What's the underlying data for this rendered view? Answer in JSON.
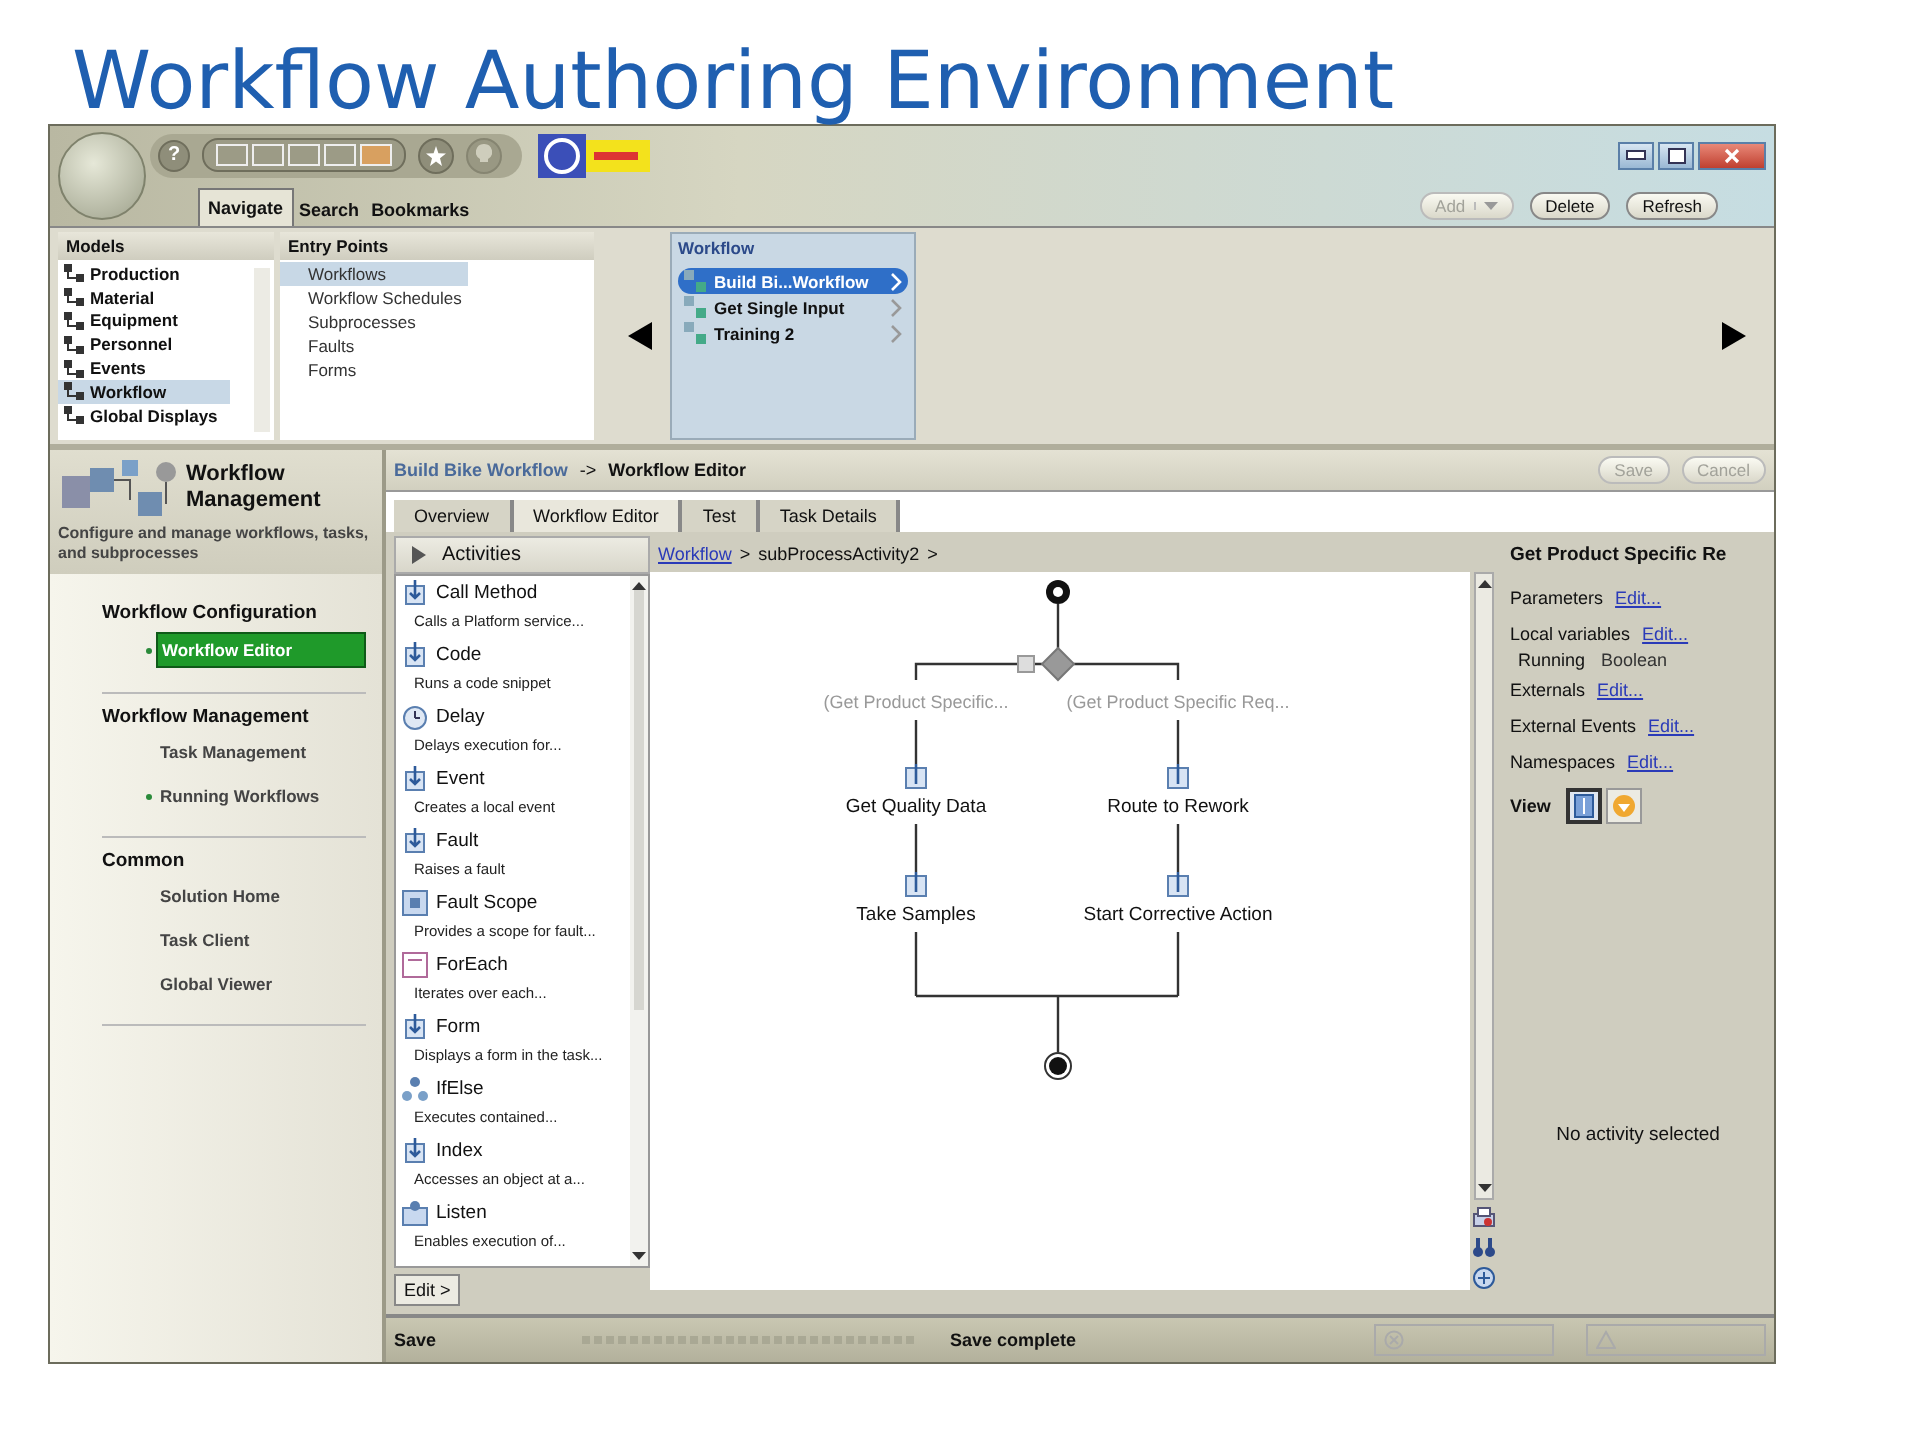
{
  "slide_title": "Workflow Authoring Environment",
  "toolbar": {
    "help": "?"
  },
  "nav_tabs": [
    {
      "label": "Navigate",
      "selected": true
    },
    {
      "label": "Search",
      "selected": false
    },
    {
      "label": "Bookmarks",
      "selected": false
    }
  ],
  "nav_actions": [
    {
      "label": "Add",
      "disabled": true,
      "dropdown": true
    },
    {
      "label": "Delete",
      "disabled": false,
      "dropdown": false
    },
    {
      "label": "Refresh",
      "disabled": false,
      "dropdown": false
    }
  ],
  "models": {
    "title": "Models",
    "items": [
      {
        "label": "Production",
        "selected": false
      },
      {
        "label": "Material",
        "selected": false
      },
      {
        "label": "Equipment",
        "selected": false
      },
      {
        "label": "Personnel",
        "selected": false
      },
      {
        "label": "Events",
        "selected": false
      },
      {
        "label": "Workflow",
        "selected": true
      },
      {
        "label": "Global Displays",
        "selected": false
      }
    ]
  },
  "entry_points": {
    "title": "Entry Points",
    "items": [
      {
        "label": "Workflows",
        "selected": true
      },
      {
        "label": "Workflow Schedules",
        "selected": false
      },
      {
        "label": "Subprocesses",
        "selected": false
      },
      {
        "label": "Faults",
        "selected": false
      },
      {
        "label": "Forms",
        "selected": false
      }
    ]
  },
  "workflows": {
    "title": "Workflow",
    "items": [
      {
        "label": "Build Bi...Workflow",
        "selected": true
      },
      {
        "label": "Get Single Input",
        "selected": false
      },
      {
        "label": "Training 2",
        "selected": false
      }
    ]
  },
  "sidebar": {
    "title": "Workflow Management",
    "description": "Configure and manage workflows, tasks, and subprocesses",
    "sections": [
      {
        "heading": "Workflow Configuration",
        "items": [
          {
            "label": "Workflow Editor",
            "selected": true,
            "bullet": true
          }
        ]
      },
      {
        "heading": "Workflow Management",
        "items": [
          {
            "label": "Task Management",
            "selected": false,
            "bullet": false
          },
          {
            "label": "Running Workflows",
            "selected": false,
            "bullet": true
          }
        ]
      },
      {
        "heading": "Common",
        "items": [
          {
            "label": "Solution Home",
            "selected": false,
            "bullet": false
          },
          {
            "label": "Task Client",
            "selected": false,
            "bullet": false
          },
          {
            "label": "Global Viewer",
            "selected": false,
            "bullet": false
          }
        ]
      }
    ]
  },
  "editor": {
    "crumb_link": "Build Bike Workflow",
    "crumb_separator": "->",
    "crumb_current": "Workflow Editor",
    "buttons": [
      {
        "label": "Save",
        "disabled": true
      },
      {
        "label": "Cancel",
        "disabled": true
      }
    ],
    "tabs": [
      {
        "label": "Overview",
        "selected": false
      },
      {
        "label": "Workflow Editor",
        "selected": true
      },
      {
        "label": "Test",
        "selected": false
      },
      {
        "label": "Task Details",
        "selected": false
      }
    ]
  },
  "activities": {
    "title": "Activities",
    "edit_button": "Edit >",
    "items": [
      {
        "name": "Call Method",
        "description": "Calls a Platform service...",
        "kind": "activity"
      },
      {
        "name": "Code",
        "description": "Runs a code snippet",
        "kind": "activity"
      },
      {
        "name": "Delay",
        "description": "Delays execution for...",
        "kind": "timer"
      },
      {
        "name": "Event",
        "description": "Creates a local event",
        "kind": "activity"
      },
      {
        "name": "Fault",
        "description": "Raises a fault",
        "kind": "activity"
      },
      {
        "name": "Fault Scope",
        "description": "Provides a scope for fault...",
        "kind": "scope"
      },
      {
        "name": "ForEach",
        "description": "Iterates over each...",
        "kind": "loop"
      },
      {
        "name": "Form",
        "description": "Displays a form in the task...",
        "kind": "activity"
      },
      {
        "name": "IfElse",
        "description": "Executes contained...",
        "kind": "branch"
      },
      {
        "name": "Index",
        "description": "Accesses an object at a...",
        "kind": "activity"
      },
      {
        "name": "Listen",
        "description": "Enables execution of...",
        "kind": "listen"
      }
    ]
  },
  "path": {
    "link": "Workflow",
    "separator": ">",
    "current": "subProcessActivity2",
    "trailing": ">"
  },
  "diagram": {
    "branches": [
      {
        "condition": "(Get Product Specific...",
        "steps": [
          "Get Quality Data",
          "Take Samples"
        ]
      },
      {
        "condition": "(Get Product Specific Req...",
        "steps": [
          "Route to Rework",
          "Start Corrective Action"
        ]
      }
    ]
  },
  "properties": {
    "title": "Get Product Specific Re",
    "sections": [
      {
        "label": "Parameters",
        "link": "Edit..."
      },
      {
        "label": "Local variables",
        "link": "Edit...",
        "variables": [
          {
            "name": "Running",
            "type": "Boolean"
          }
        ]
      },
      {
        "label": "Externals",
        "link": "Edit..."
      },
      {
        "label": "External Events",
        "link": "Edit..."
      },
      {
        "label": "Namespaces",
        "link": "Edit..."
      }
    ],
    "view_label": "View",
    "view_modes": [
      {
        "selected": true
      },
      {
        "selected": false
      }
    ],
    "empty_message": "No activity selected"
  },
  "status_bar": {
    "action": "Save",
    "message": "Save complete"
  }
}
